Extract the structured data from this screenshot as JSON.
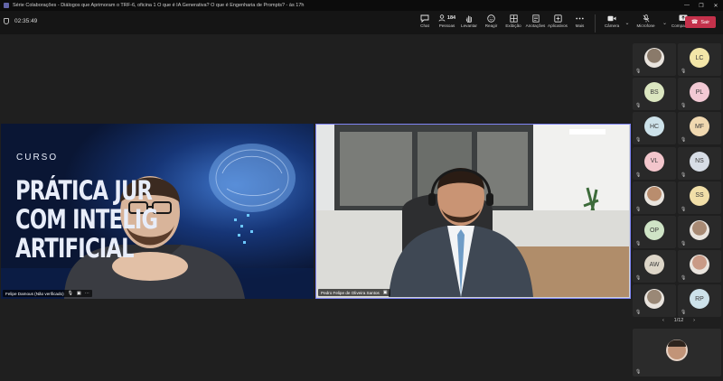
{
  "window": {
    "title": "Série Colaborações - Diálogos que Aprimoram o TRF-6, oficina 1 O que é IA Generativa? O que é Engenharia de Prompts? - às 17h",
    "controls": [
      "—",
      "❐",
      "✕"
    ]
  },
  "meeting": {
    "timer": "02:35:49"
  },
  "toolbar": {
    "chat": "Chat",
    "people_count": "184",
    "people": "Pessoas",
    "raise": "Levantar",
    "react": "Reagir",
    "view": "Exibição",
    "notes": "Anotações",
    "apps": "Aplicativos",
    "more": "Mais",
    "camera": "Câmera",
    "mic": "Microfone",
    "share": "Compartilhar",
    "leave": "Sair"
  },
  "stage": {
    "left_tile": {
      "name": "Felipe Damous (Não verificado)",
      "slide_word": "CURSO",
      "slide_lines": [
        "PRÁTICA JUR",
        "COM INTELIG",
        "ARTIFICIAL"
      ]
    },
    "right_tile": {
      "name": "Pedro Felipe de Oliveira Santos"
    }
  },
  "gallery": {
    "participants": [
      {
        "initials": "",
        "color": "#8a7a6a",
        "photo": true
      },
      {
        "initials": "LC",
        "color": "#f3e6a8"
      },
      {
        "initials": "BS",
        "color": "#dbe6c0"
      },
      {
        "initials": "PL",
        "color": "#f2c9d4"
      },
      {
        "initials": "HC",
        "color": "#cde2ea"
      },
      {
        "initials": "MF",
        "color": "#f0d8b0"
      },
      {
        "initials": "VL",
        "color": "#f3c6cc"
      },
      {
        "initials": "NS",
        "color": "#d7dde6"
      },
      {
        "initials": "",
        "color": "#b98d6e",
        "photo": true
      },
      {
        "initials": "SS",
        "color": "#f1dfa8"
      },
      {
        "initials": "OP",
        "color": "#cfe4c6"
      },
      {
        "initials": "",
        "color": "#a88a74",
        "photo": true
      },
      {
        "initials": "AW",
        "color": "#ddd6c8"
      },
      {
        "initials": "",
        "color": "#c99a86",
        "photo": true
      },
      {
        "initials": "",
        "color": "#9a8876",
        "photo": true
      },
      {
        "initials": "RP",
        "color": "#cde2ea"
      }
    ],
    "pager": "1/12"
  }
}
